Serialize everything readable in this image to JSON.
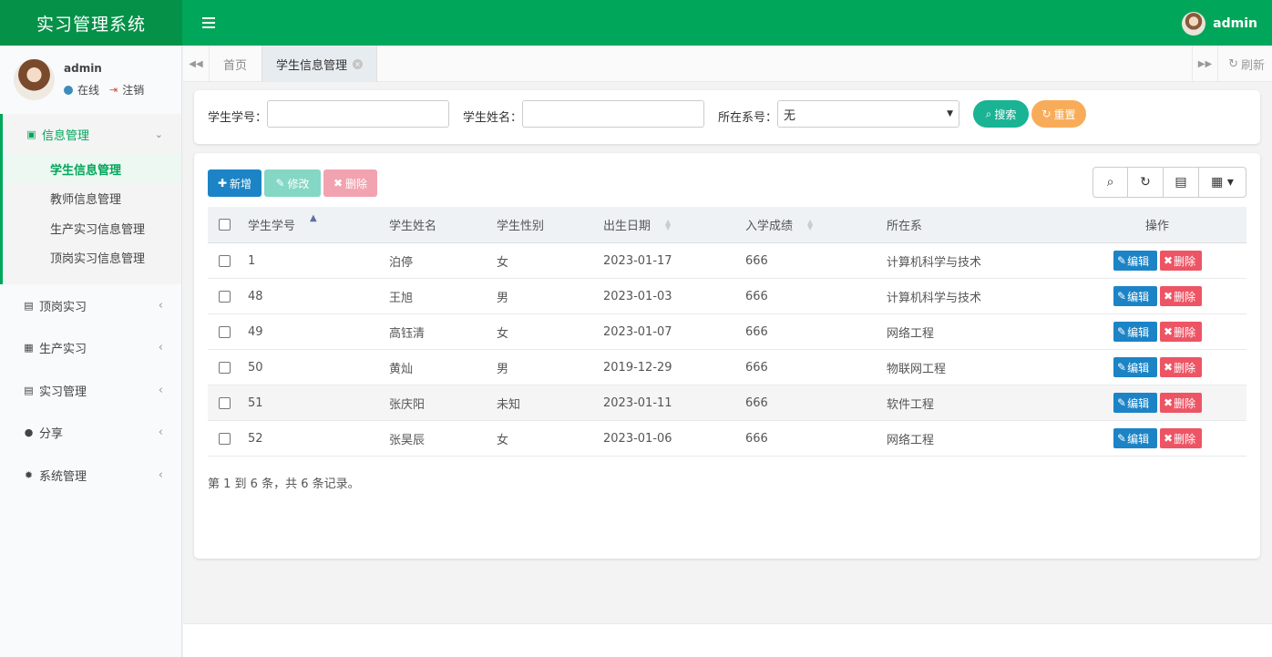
{
  "app": {
    "title": "实习管理系统"
  },
  "header": {
    "username": "admin"
  },
  "sidebar": {
    "user": {
      "name": "admin",
      "status": "在线",
      "logout": "注销"
    },
    "open_group": {
      "label": "信息管理",
      "items": [
        {
          "label": "学生信息管理",
          "active": true
        },
        {
          "label": "教师信息管理"
        },
        {
          "label": "生产实习信息管理"
        },
        {
          "label": "顶岗实习信息管理"
        }
      ]
    },
    "groups": [
      {
        "label": "顶岗实习",
        "icon": "id-card-icon"
      },
      {
        "label": "生产实习",
        "icon": "user-card-icon"
      },
      {
        "label": "实习管理",
        "icon": "id-card-icon"
      },
      {
        "label": "分享",
        "icon": "comment-icon"
      },
      {
        "label": "系统管理",
        "icon": "gear-icon"
      }
    ]
  },
  "tabs": {
    "home": "首页",
    "current": "学生信息管理",
    "refresh": "刷新"
  },
  "search": {
    "student_no_label": "学生学号：",
    "student_name_label": "学生姓名：",
    "dept_label": "所在系号：",
    "dept_value": "无",
    "search_button": "搜索",
    "reset_button": "重置"
  },
  "toolbar": {
    "add": "新增",
    "edit": "修改",
    "delete": "删除"
  },
  "table": {
    "columns": [
      "学生学号",
      "学生姓名",
      "学生性别",
      "出生日期",
      "入学成绩",
      "所在系",
      "操作"
    ],
    "rows": [
      {
        "no": "1",
        "name": "泊停",
        "gender": "女",
        "birth": "2023-01-17",
        "score": "666",
        "dept": "计算机科学与技术"
      },
      {
        "no": "48",
        "name": "王旭",
        "gender": "男",
        "birth": "2023-01-03",
        "score": "666",
        "dept": "计算机科学与技术"
      },
      {
        "no": "49",
        "name": "高钰清",
        "gender": "女",
        "birth": "2023-01-07",
        "score": "666",
        "dept": "网络工程"
      },
      {
        "no": "50",
        "name": "黄灿",
        "gender": "男",
        "birth": "2019-12-29",
        "score": "666",
        "dept": "物联网工程"
      },
      {
        "no": "51",
        "name": "张庆阳",
        "gender": "未知",
        "birth": "2023-01-11",
        "score": "666",
        "dept": "软件工程"
      },
      {
        "no": "52",
        "name": "张昊辰",
        "gender": "女",
        "birth": "2023-01-06",
        "score": "666",
        "dept": "网络工程"
      }
    ],
    "row_edit": "编辑",
    "row_delete": "删除",
    "pagination": "第 1 到 6 条，共 6 条记录。"
  },
  "colors": {
    "brand": "#00a65a",
    "logo_bg": "#059148",
    "primary": "#1c84c6",
    "danger": "#ed5565",
    "success": "#1ab394",
    "warning": "#f8ac59"
  }
}
